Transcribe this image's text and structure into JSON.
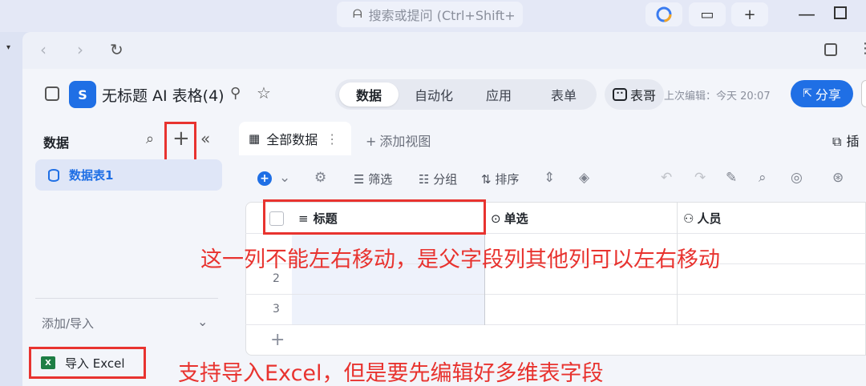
{
  "browser": {
    "search_placeholder": "搜索或提问 (Ctrl+Shift+"
  },
  "app": {
    "logo_letter": "S",
    "title": "无标题 AI 表格(4)",
    "tabs": [
      {
        "label": "数据",
        "active": true
      },
      {
        "label": "自动化",
        "active": false
      },
      {
        "label": "应用",
        "active": false
      },
      {
        "label": "表单",
        "active": false
      }
    ],
    "assistant_label": "表哥",
    "last_edit": "上次编辑：今天 20:07",
    "share_label": "分享",
    "accent_color": "#1f6fe5"
  },
  "sidebar": {
    "title": "数据",
    "items": [
      {
        "label": "数据表1",
        "selected": true
      }
    ],
    "add_import_label": "添加/导入",
    "import_excel_label": "导入 Excel",
    "excel_badge": "X"
  },
  "main": {
    "view_tab": "全部数据",
    "add_view": "添加视图",
    "plugin_label": "插",
    "toolbar": {
      "filter": "筛选",
      "group": "分组",
      "sort": "排序"
    },
    "table": {
      "columns": [
        {
          "label": "标题",
          "icon": "text-icon"
        },
        {
          "label": "单选",
          "icon": "single-select-icon"
        },
        {
          "label": "人员",
          "icon": "person-icon"
        }
      ],
      "row_numbers": [
        "2",
        "3"
      ]
    }
  },
  "annotations": {
    "column_note": "这一列不能左右移动，是父字段列其他列可以左右移动",
    "import_note": "支持导入Excel，但是要先编辑好多维表字段"
  },
  "annotation_color": "#e8332f"
}
